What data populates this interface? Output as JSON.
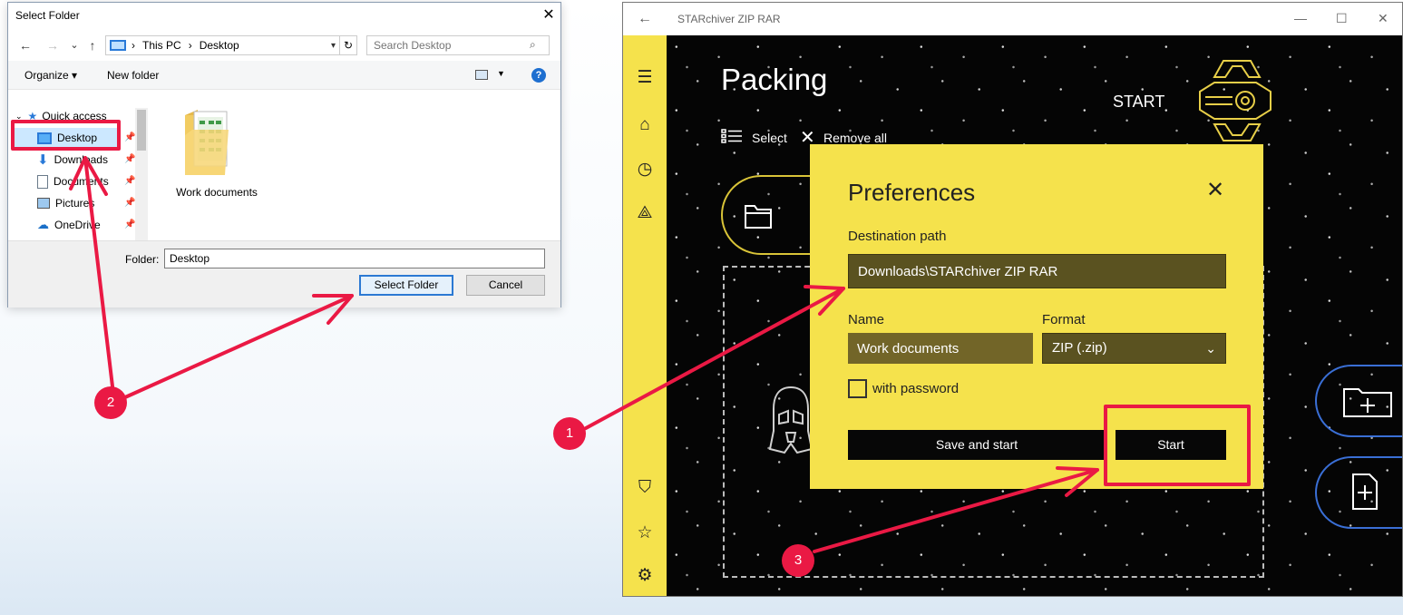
{
  "dialog": {
    "title": "Select Folder",
    "close_glyph": "✕",
    "nav_back": "←",
    "nav_forward": "→",
    "nav_recent": "⌄",
    "nav_up": "↑",
    "breadcrumb": [
      "This PC",
      "Desktop"
    ],
    "breadcrumb_sep": "›",
    "search_placeholder": "Search Desktop",
    "toolbar": {
      "organize": "Organize ▾",
      "new_folder": "New folder",
      "help": "?"
    },
    "tree": [
      {
        "label": "Quick access",
        "icon": "star-icon"
      },
      {
        "label": "Desktop",
        "icon": "desktop-icon",
        "selected": true
      },
      {
        "label": "Downloads",
        "icon": "download-icon"
      },
      {
        "label": "Documents",
        "icon": "document-icon"
      },
      {
        "label": "Pictures",
        "icon": "picture-icon"
      },
      {
        "label": "OneDrive",
        "icon": "cloud-icon"
      }
    ],
    "item": {
      "label": "Work documents",
      "icon": "folder-icon"
    },
    "folder_label": "Folder:",
    "folder_value": "Desktop",
    "select_button": "Select Folder",
    "cancel_button": "Cancel"
  },
  "app": {
    "title": "STARchiver ZIP RAR",
    "back": "←",
    "win_min": "—",
    "win_max": "☐",
    "win_close": "✕",
    "page_title": "Packing",
    "start_label": "START",
    "select_label": "Select",
    "remove_all_label": "Remove all",
    "sidebar_icons": [
      "menu-icon",
      "home-icon",
      "history-icon",
      "share-icon",
      "store-icon",
      "star-icon",
      "settings-icon"
    ],
    "sidebar_glyphs": [
      "☰",
      "⌂",
      "◷",
      "⟁",
      "⛉",
      "☆",
      "⚙"
    ]
  },
  "preferences": {
    "title": "Preferences",
    "close_glyph": "✕",
    "destination_label": "Destination path",
    "destination_value": "Downloads\\STARchiver ZIP RAR",
    "name_label": "Name",
    "name_value": "Work documents",
    "format_label": "Format",
    "format_value": "ZIP (.zip)",
    "password_label": "with password",
    "save_and_start": "Save and start",
    "start": "Start"
  },
  "annotations": {
    "color": "#ea1944",
    "badges": [
      "1",
      "2",
      "3"
    ]
  },
  "colors": {
    "app_accent": "#f5e24c",
    "app_bg": "#050505",
    "dialog_selection": "#cce8ff",
    "right_pill_border": "#3a6fd6"
  }
}
